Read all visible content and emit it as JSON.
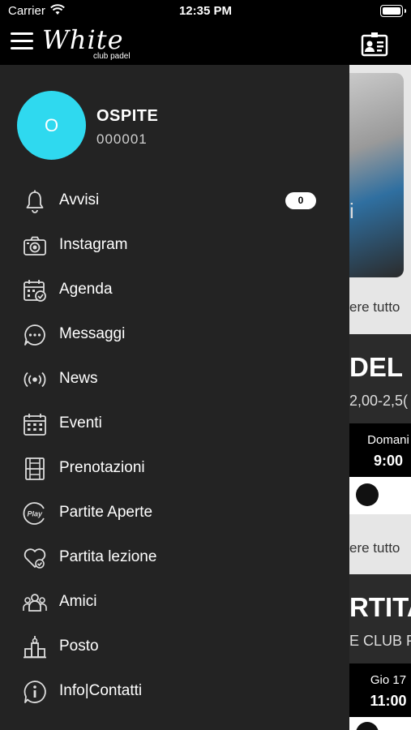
{
  "status_bar": {
    "carrier": "Carrier",
    "time": "12:35 PM"
  },
  "header": {
    "logo_text": "White",
    "logo_subtext": "club padel"
  },
  "user": {
    "initial": "O",
    "name": "OSPITE",
    "code": "000001"
  },
  "menu": [
    {
      "label": "Avvisi",
      "icon": "bell-icon",
      "badge": "0"
    },
    {
      "label": "Instagram",
      "icon": "camera-icon"
    },
    {
      "label": "Agenda",
      "icon": "calendar-check-icon"
    },
    {
      "label": "Messaggi",
      "icon": "chat-bubble-icon"
    },
    {
      "label": "News",
      "icon": "broadcast-icon"
    },
    {
      "label": "Eventi",
      "icon": "calendar-grid-icon"
    },
    {
      "label": "Prenotazioni",
      "icon": "court-icon"
    },
    {
      "label": "Partite Aperte",
      "icon": "play-icon"
    },
    {
      "label": "Partita lezione",
      "icon": "heart-icon"
    },
    {
      "label": "Amici",
      "icon": "friends-icon"
    },
    {
      "label": "Posto",
      "icon": "venue-icon"
    },
    {
      "label": "Info|Contatti",
      "icon": "info-icon"
    }
  ],
  "background": {
    "photo_letter": "i",
    "see_all_1": "ere tutto",
    "card1_title": "DEL",
    "card1_price": "2,00-2,5(",
    "card1_day": "Domani",
    "card1_time": "9:00",
    "see_all_2": "ere tutto",
    "card2_title": "RTITA",
    "card2_subtitle": "E CLUB P",
    "card2_day": "Gio 17",
    "card2_time": "11:00"
  }
}
